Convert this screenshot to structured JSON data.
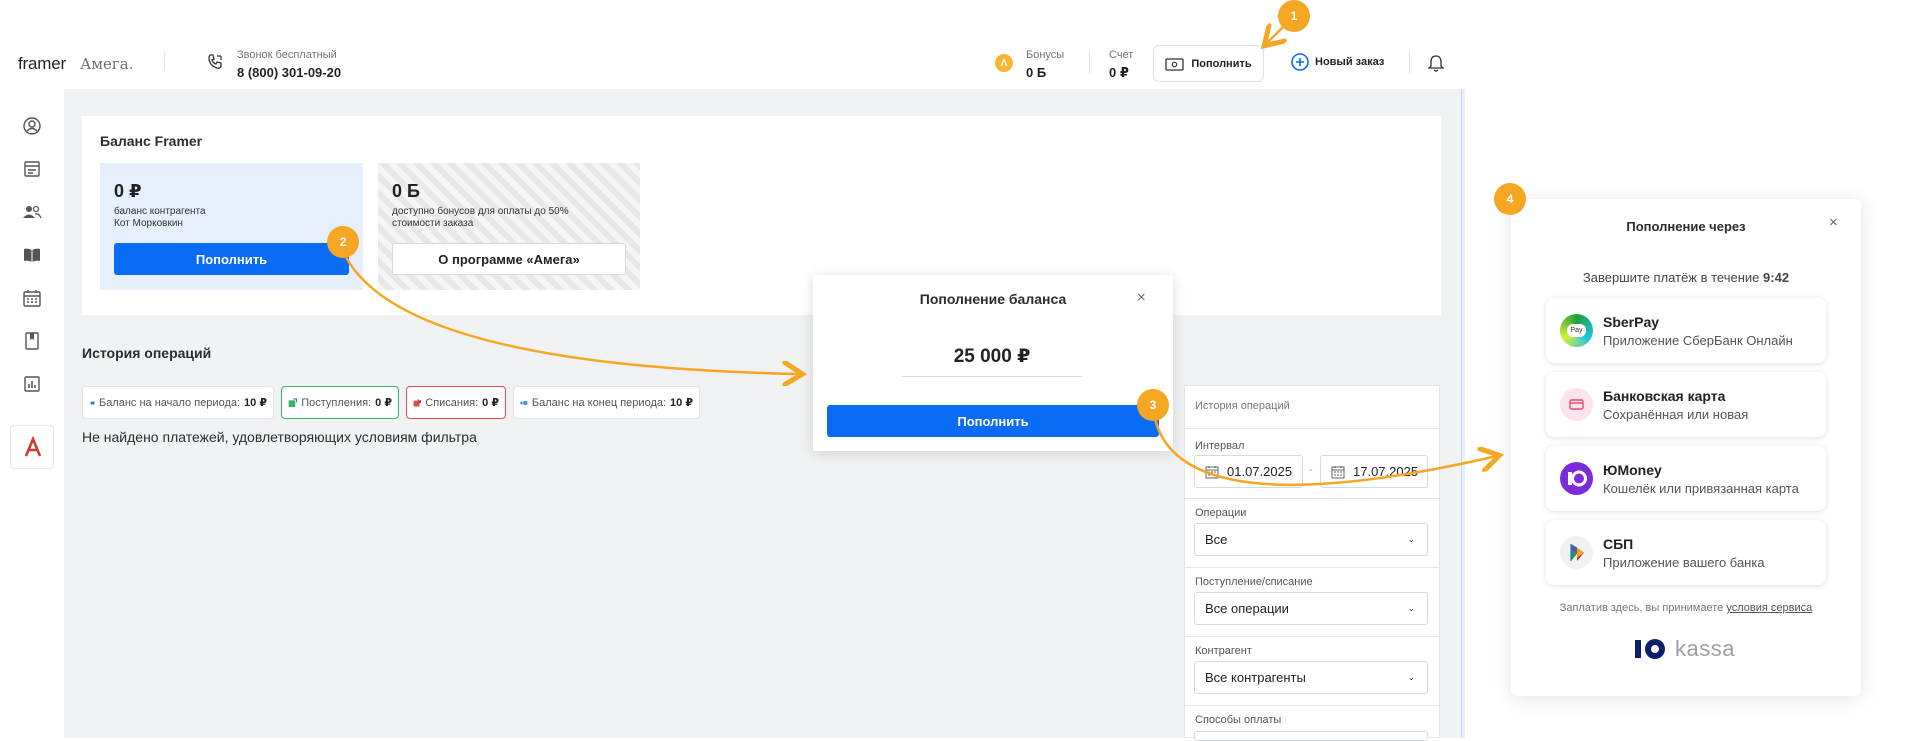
{
  "header": {
    "logo_framer": "framer",
    "logo_amega": "Амега.",
    "phone_label": "Звонок бесплатный",
    "phone_number": "8 (800) 301-09-20",
    "bonus_label": "Бонусы",
    "bonus_value": "0 Б",
    "account_label": "Счет",
    "account_value": "0 ₽",
    "topup_label": "Пополнить",
    "new_order_label": "Новый заказ"
  },
  "sidebar": {
    "icons": [
      "user-circle-icon",
      "document-icon",
      "people-icon",
      "book-icon",
      "calendar-icon",
      "bookmark-icon",
      "chart-icon",
      "amega-logo-icon"
    ]
  },
  "balance": {
    "title": "Баланс Framer",
    "contractor_amount": "0 ₽",
    "contractor_desc_1": "баланс контрагента",
    "contractor_desc_2": "Кот Морковкин",
    "contractor_button": "Пополнить",
    "bonus_amount": "0 Б",
    "bonus_desc_1": "доступно бонусов для оплаты до 50%",
    "bonus_desc_2": "стоимости заказа",
    "bonus_button": "О программе «Амега»"
  },
  "history": {
    "title": "История операций",
    "chips": {
      "start_label": "Баланс на начало периода:",
      "start_value": "10 ₽",
      "income_label": "Поступления:",
      "income_value": "0 ₽",
      "expense_label": "Списания:",
      "expense_value": "0 ₽",
      "end_label": "Баланс на конец периода:",
      "end_value": "10 ₽"
    },
    "empty_message": "Не найдено платежей, удовлетворяющих условиям фильтра"
  },
  "filters": {
    "title": "История операций",
    "interval_label": "Интервал",
    "date_from": "01.07.2025",
    "date_sep": "-",
    "date_to": "17.07.2025",
    "operations_label": "Операции",
    "operations_value": "Все",
    "flow_label": "Поступление/списание",
    "flow_value": "Все операции",
    "contractor_label": "Контрагент",
    "contractor_value": "Все контрагенты",
    "payment_methods_label": "Способы оплаты"
  },
  "modal": {
    "title": "Пополнение баланса",
    "amount": "25 000 ₽",
    "button": "Пополнить",
    "close": "×"
  },
  "kassa": {
    "title": "Пополнение через",
    "timer_text": "Завершите платёж в течение",
    "timer_value": "9:42",
    "close": "×",
    "methods": [
      {
        "title": "SberPay",
        "subtitle": "Приложение СберБанк Онлайн",
        "icon": "sberpay-icon"
      },
      {
        "title": "Банковская карта",
        "subtitle": "Сохранённая или новая",
        "icon": "bank-card-icon"
      },
      {
        "title": "ЮMoney",
        "subtitle": "Кошелёк или привязанная карта",
        "icon": "yoomoney-icon"
      },
      {
        "title": "СБП",
        "subtitle": "Приложение вашего банка",
        "icon": "sbp-icon"
      }
    ],
    "terms_text": "Заплатив здесь, вы принимаете",
    "terms_link": "условия сервиса",
    "footer_logo": "kassa"
  },
  "annotations": {
    "badge_1": "1",
    "badge_2": "2",
    "badge_3": "3",
    "badge_4": "4"
  },
  "colors": {
    "accent_blue": "#0a6cf5",
    "annotation_orange": "#f5a623",
    "income_green": "#33b36b",
    "expense_red": "#e5484d"
  }
}
